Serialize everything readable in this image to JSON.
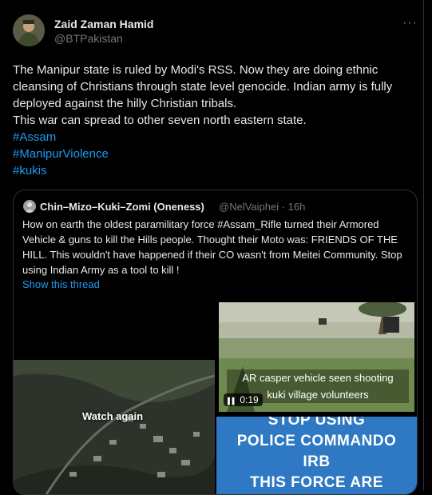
{
  "author": {
    "name": "Zaid Zaman Hamid",
    "handle": "@BTPakistan",
    "more_icon": "···"
  },
  "tweet": {
    "text": "The Manipur state is ruled by Modi's RSS. Now they are doing ethnic\ncleansing of Christians through state level genocide. Indian army is fully\ndeployed against the hilly Christian tribals.\nThis war can spread to other seven north eastern state.",
    "hashtags": [
      "#Assam",
      "#ManipurViolence",
      "#kukis"
    ]
  },
  "quoted": {
    "name": "Chin–Mizo–Kuki–Zomi (Oneness)",
    "handle": "@NelVaiphei · 16h",
    "text": "How on earth the oldest paramilitary force #Assam_Rifle turned their Armored Vehicle & guns to kill the Hills people. Thought their Moto was: FRIENDS OF THE HILL. This wouldn't have happened if their CO wasn't from Meitei Community. Stop using Indian Army as a tool to kill !",
    "show_thread": "Show this thread",
    "media": {
      "left_video": {
        "overlay": "Watch again"
      },
      "right_video": {
        "caption_line1": "AR casper vehicle seen shooting",
        "caption_line2": "kuki village volunteers",
        "duration": "0:19",
        "play_icon": "▌▌"
      },
      "image_text": [
        "STOP USING",
        "POLICE COMMANDO",
        "IRB",
        "THIS FORCE ARE"
      ]
    }
  },
  "colors": {
    "accent": "#1d9bf0",
    "muted": "#71767b",
    "text": "#e7e9ea",
    "bg": "#000000",
    "border": "#2f3336"
  }
}
